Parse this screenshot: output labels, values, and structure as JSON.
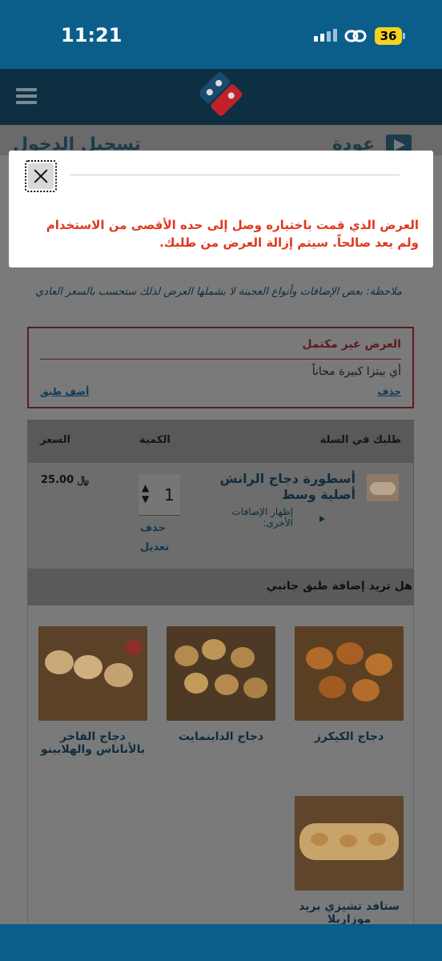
{
  "status_bar": {
    "time": "11:21",
    "battery": "36"
  },
  "login_bar": {
    "title": "تسجيل الدخول",
    "back_label": "عودة"
  },
  "modal": {
    "message": "العرض الذي قمت باختياره وصل إلى حده الأقصى من الاستخدام ولم يعد صالحاً. سيتم إزالة العرض من طلبك."
  },
  "note": "ملاحظة: بعض الإضافات وأنواع العجينة لا يشملها العرض لذلك ستحسب بالسعر العادي",
  "offer": {
    "title": "العرض غير مكتمل",
    "item": "أي بيتزا كبيرة مجاناً",
    "delete_label": "حذف",
    "add_label": "أضف طبق"
  },
  "cart": {
    "headers": {
      "item": "طلبك في السلة",
      "quantity": "الكمية",
      "price": "السعر"
    },
    "item": {
      "name": "أسطورة دجاج الرانش أصلية وسط",
      "extras_label": "إظهار الإضافات الأخرى:",
      "quantity": "1",
      "delete_label": "حذف",
      "edit_label": "تعديل",
      "price": "25.00",
      "currency": "﷼"
    }
  },
  "side_dishes": {
    "title": "هل تريد إضافة طبق جانبي",
    "items": [
      {
        "name": "دجاج الكيكرز"
      },
      {
        "name": "دجاج الداينمايت"
      },
      {
        "name": "دجاج الفاخر بالأناناس والهلابينو"
      },
      {
        "name": "ستافد تشيزي بريد موزاريلا"
      }
    ]
  },
  "colors": {
    "status_bar": "#0b5e8a",
    "nav": "#0e2f42",
    "error_text": "#e0381f",
    "offer_border": "#5e1b20",
    "link": "#0c3b58"
  }
}
